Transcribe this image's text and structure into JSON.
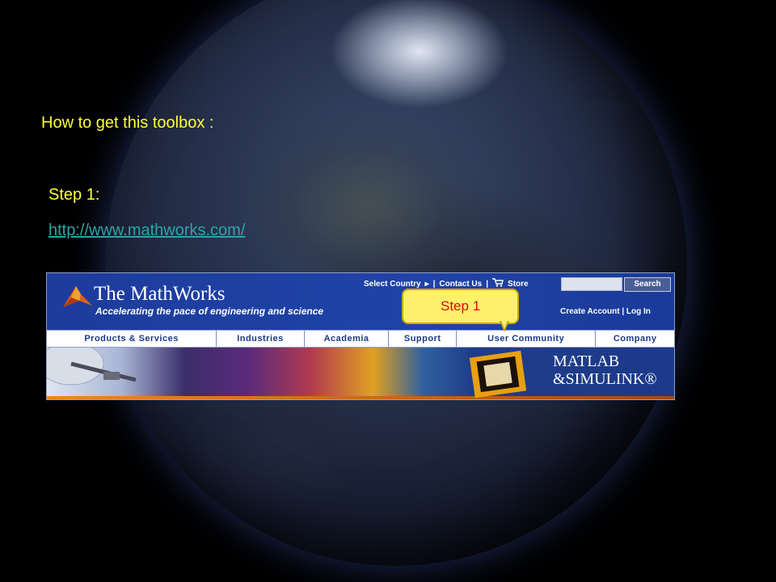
{
  "slide": {
    "title": "How to get this toolbox :",
    "step_label": "Step 1:",
    "url": "http://www.mathworks.com/"
  },
  "website": {
    "brand": "The MathWorks",
    "tagline": "Accelerating the pace of engineering and science",
    "top_links": {
      "select_country": "Select Country",
      "contact_us": "Contact Us",
      "store": "Store",
      "separator": "|"
    },
    "search_button": "Search",
    "account_links": "Create Account | Log In",
    "nav": [
      "Products & Services",
      "Industries",
      "Academia",
      "Support",
      "User Community",
      "Company"
    ],
    "product_logo_line1": "MATLAB",
    "product_logo_line2": "&SIMULINK®"
  },
  "callout": {
    "text": "Step 1"
  },
  "colors": {
    "slide_text": "#ffff33",
    "link": "#2aa6a6",
    "site_blue": "#1f43a8",
    "callout_fill": "#fdf06a",
    "callout_text": "#d01010"
  },
  "icons": [
    "triangle-right-icon",
    "shopping-cart-icon",
    "mathworks-logo-icon"
  ]
}
